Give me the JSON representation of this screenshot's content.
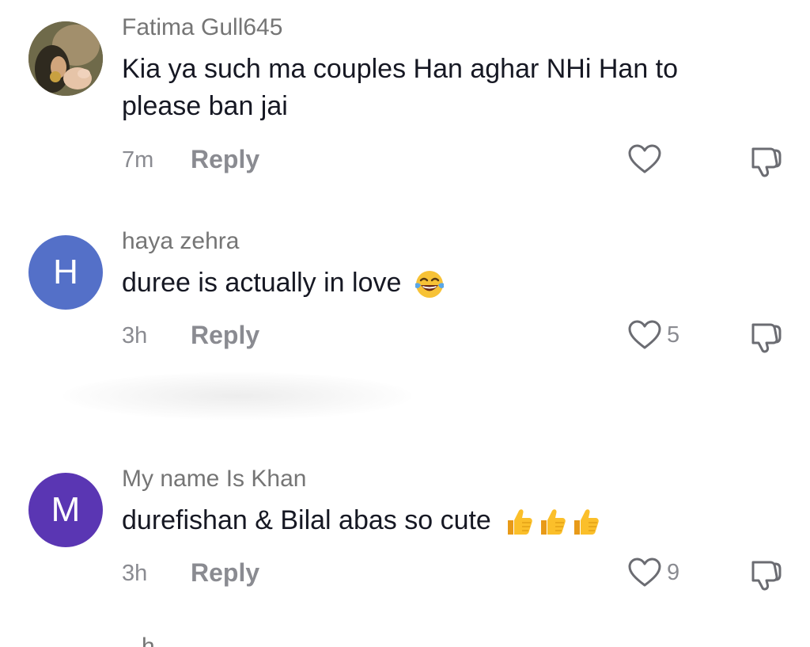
{
  "comments": [
    {
      "username": "Fatima Gull645",
      "text": "Kia ya such ma couples Han aghar NHi Han to please ban jai",
      "emoji": "",
      "time": "7m",
      "reply": "Reply",
      "likes": "",
      "avatar": {
        "type": "photo",
        "icon": "profile-photo"
      }
    },
    {
      "username": "haya zehra",
      "text": "duree is actually in love",
      "emoji": "face-with-tears-of-joy",
      "time": "3h",
      "reply": "Reply",
      "likes": "5",
      "avatar": {
        "type": "letter",
        "letter": "H",
        "color": "#5470c8"
      }
    },
    {
      "username": "My name Is Khan",
      "text": "durefishan & Bilal abas so cute",
      "emoji": "thumbs-up x3",
      "time": "3h",
      "reply": "Reply",
      "likes": "9",
      "avatar": {
        "type": "letter",
        "letter": "M",
        "color": "#5a36b3"
      }
    }
  ],
  "partial_username": "...h...",
  "icons": {
    "like": "heart-outline-icon",
    "dislike": "thumbs-down-outline-icon"
  },
  "colors": {
    "text": "#161823",
    "secondary": "#8a8b91",
    "username": "#757575"
  }
}
